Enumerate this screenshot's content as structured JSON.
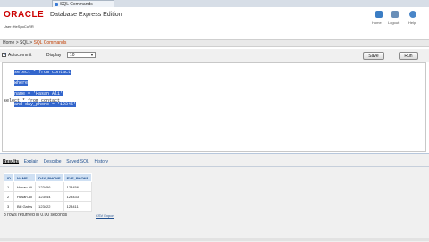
{
  "browser": {
    "tab_title": "SQL Commands"
  },
  "header": {
    "logo": "ORACLE",
    "product": "Database Express Edition",
    "user": "User: HeSpoCoRR",
    "actions": [
      {
        "label": "Home",
        "icon": "home-icon",
        "color": "#3b7dc4"
      },
      {
        "label": "Logout",
        "icon": "logout-icon",
        "color": "#6a8fb8"
      },
      {
        "label": "Help",
        "icon": "help-icon",
        "color": "#4a86c8"
      }
    ]
  },
  "breadcrumb": {
    "items": [
      "Home",
      "SQL",
      "SQL Commands"
    ],
    "separator": ">"
  },
  "toolbar": {
    "autocommit_label": "Autocommit",
    "autocommit_checked": true,
    "display_label": "Display",
    "display_value": "10",
    "save_label": "Save",
    "run_label": "Run"
  },
  "editor": {
    "selected_lines": [
      "select * from contact",
      "where",
      "name = 'Hasan Ali'",
      "and day_phone = '12345'"
    ],
    "other_lines": [
      "select * from contact"
    ]
  },
  "results_tabs": [
    "Results",
    "Explain",
    "Describe",
    "Saved SQL",
    "History"
  ],
  "results_table": {
    "columns": [
      "ID",
      "NAME",
      "DAY_PHONE",
      "EVE_PHONE"
    ],
    "rows": [
      [
        "1",
        "Hasan Ali",
        "123456",
        "123456"
      ],
      [
        "2",
        "Hasan Ali",
        "123444",
        "123433"
      ],
      [
        "3",
        "Bill Gates",
        "123422",
        "123411"
      ]
    ]
  },
  "rows_info": "3 rows returned in 0.00 seconds",
  "csv_link": "CSV Export",
  "colors": {
    "oracle_red": "#cc0000",
    "accent_blue": "#1f4f8f",
    "selection": "#3366cc"
  }
}
